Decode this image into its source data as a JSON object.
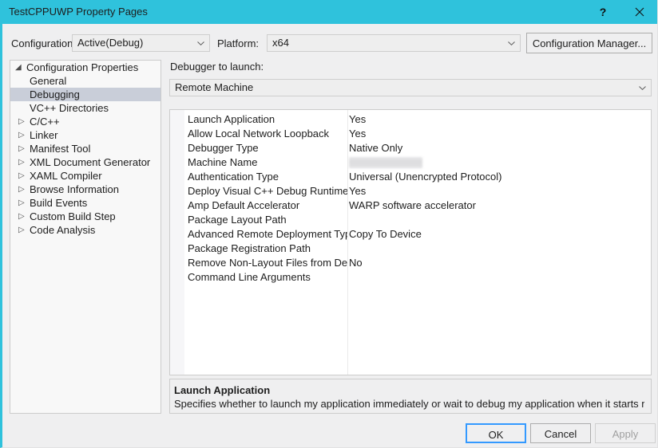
{
  "window": {
    "title": "TestCPPUWP Property Pages",
    "help_icon": "question-mark-icon",
    "close_icon": "close-x-icon"
  },
  "config_bar": {
    "configuration_label": "Configuration:",
    "configuration_value": "Active(Debug)",
    "platform_label": "Platform:",
    "platform_value": "x64",
    "configuration_manager_button": "Configuration Manager..."
  },
  "tree": {
    "items": [
      {
        "label": "Configuration Properties",
        "arrow": "◢",
        "level": "root",
        "selected": false
      },
      {
        "label": "General",
        "arrow": "",
        "level": "child",
        "selected": false
      },
      {
        "label": "Debugging",
        "arrow": "",
        "level": "child",
        "selected": true
      },
      {
        "label": "VC++ Directories",
        "arrow": "",
        "level": "child",
        "selected": false
      },
      {
        "label": "C/C++",
        "arrow": "▷",
        "level": "group",
        "selected": false
      },
      {
        "label": "Linker",
        "arrow": "▷",
        "level": "group",
        "selected": false
      },
      {
        "label": "Manifest Tool",
        "arrow": "▷",
        "level": "group",
        "selected": false
      },
      {
        "label": "XML Document Generator",
        "arrow": "▷",
        "level": "group",
        "selected": false
      },
      {
        "label": "XAML Compiler",
        "arrow": "▷",
        "level": "group",
        "selected": false
      },
      {
        "label": "Browse Information",
        "arrow": "▷",
        "level": "group",
        "selected": false
      },
      {
        "label": "Build Events",
        "arrow": "▷",
        "level": "group",
        "selected": false
      },
      {
        "label": "Custom Build Step",
        "arrow": "▷",
        "level": "group",
        "selected": false
      },
      {
        "label": "Code Analysis",
        "arrow": "▷",
        "level": "group",
        "selected": false
      }
    ]
  },
  "right_pane": {
    "debugger_label": "Debugger to launch:",
    "debugger_value": "Remote Machine",
    "properties": [
      {
        "name": "Launch Application",
        "value": "Yes",
        "redacted": false
      },
      {
        "name": "Allow Local Network Loopback",
        "value": "Yes",
        "redacted": false
      },
      {
        "name": "Debugger Type",
        "value": "Native Only",
        "redacted": false
      },
      {
        "name": "Machine Name",
        "value": "",
        "redacted": true
      },
      {
        "name": "Authentication Type",
        "value": "Universal (Unencrypted Protocol)",
        "redacted": false
      },
      {
        "name": "Deploy Visual C++ Debug Runtime Libraries",
        "value": "Yes",
        "redacted": false
      },
      {
        "name": "Amp Default Accelerator",
        "value": "WARP software accelerator",
        "redacted": false
      },
      {
        "name": "Package Layout Path",
        "value": "",
        "redacted": false
      },
      {
        "name": "Advanced Remote Deployment Type",
        "value": "Copy To Device",
        "redacted": false
      },
      {
        "name": "Package Registration Path",
        "value": "",
        "redacted": false
      },
      {
        "name": "Remove Non-Layout Files from Device",
        "value": "No",
        "redacted": false
      },
      {
        "name": "Command Line Arguments",
        "value": "",
        "redacted": false
      }
    ],
    "description": {
      "title": "Launch Application",
      "text": "Specifies whether to launch my application immediately or wait to debug my application when it starts runnin…"
    }
  },
  "footer": {
    "ok_label": "OK",
    "cancel_label": "Cancel",
    "apply_label": "Apply"
  },
  "colors": {
    "titlebar": "#2FC2DC",
    "selection": "#C9CED9",
    "focus_border": "#3399FF",
    "dialog_bg": "#EFEFF0"
  }
}
